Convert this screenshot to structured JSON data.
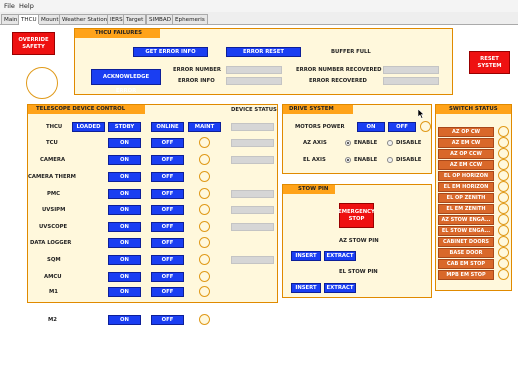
{
  "menu": {
    "file": "File",
    "help": "Help"
  },
  "tabs": [
    "Main",
    "THCU",
    "Mount",
    "Weather Station",
    "IERS",
    "Target",
    "SIMBAD",
    "Ephemeris"
  ],
  "override_safety": "OVERRIDE SAFETY",
  "reset_system": "RESET SYSTEM",
  "thcu_failures": {
    "title": "THCU FAILURES",
    "get_error_info": "GET ERROR INFO",
    "error_reset": "ERROR RESET",
    "buffer_full": "BUFFER FULL",
    "acknowledge_error": "ACKNOWLEDGE ERROR",
    "error_number": "ERROR NUMBER",
    "error_info": "ERROR INFO",
    "error_number_recovered": "ERROR NUMBER RECOVERED",
    "error_recovered": "ERROR RECOVERED"
  },
  "telescope": {
    "title": "TELESCOPE DEVICE CONTROL",
    "device_status": "DEVICE STATUS",
    "thcu_label": "THCU",
    "loaded": "LOADED",
    "stdby": "STDBY",
    "online": "ONLINE",
    "maint": "MAINT",
    "on": "ON",
    "off": "OFF",
    "devices": [
      "TCU",
      "CAMERA",
      "CAMERA THERM",
      "PMC",
      "UVSIPM",
      "UVSCOPE",
      "DATA LOGGER",
      "SQM",
      "AMCU",
      "M1",
      "M2"
    ]
  },
  "drive": {
    "title": "DRIVE SYSTEM",
    "motors_power": "MOTORS POWER",
    "on": "ON",
    "off": "OFF",
    "az_axis": "AZ AXIS",
    "el_axis": "EL AXIS",
    "enable": "ENABLE",
    "disable": "DISABLE"
  },
  "stow": {
    "title": "STOW PIN",
    "emergency_stop": "EMERGENCY STOP",
    "az_stow_pin": "AZ STOW PIN",
    "el_stow_pin": "EL STOW PIN",
    "insert": "INSERT",
    "extract": "EXTRACT"
  },
  "switch_status": {
    "title": "SWITCH STATUS",
    "items": [
      "AZ OP CW",
      "AZ EM CW",
      "AZ OP CCW",
      "AZ EM CCW",
      "EL OP HORIZON",
      "EL EM HORIZON",
      "EL OP ZENITH",
      "EL EM ZENITH",
      "AZ STOW ENGA...",
      "EL STOW ENGA...",
      "CABINET DOORS",
      "BASE DOOR",
      "CAB EM STOP",
      "MPB EM STOP"
    ]
  },
  "colors": {
    "panel_bg": "#fff8dc",
    "accent_orange": "#ffa31a",
    "button_blue": "#1a3ef2",
    "button_red": "#ee1111",
    "switch_orange": "#d9682a"
  }
}
